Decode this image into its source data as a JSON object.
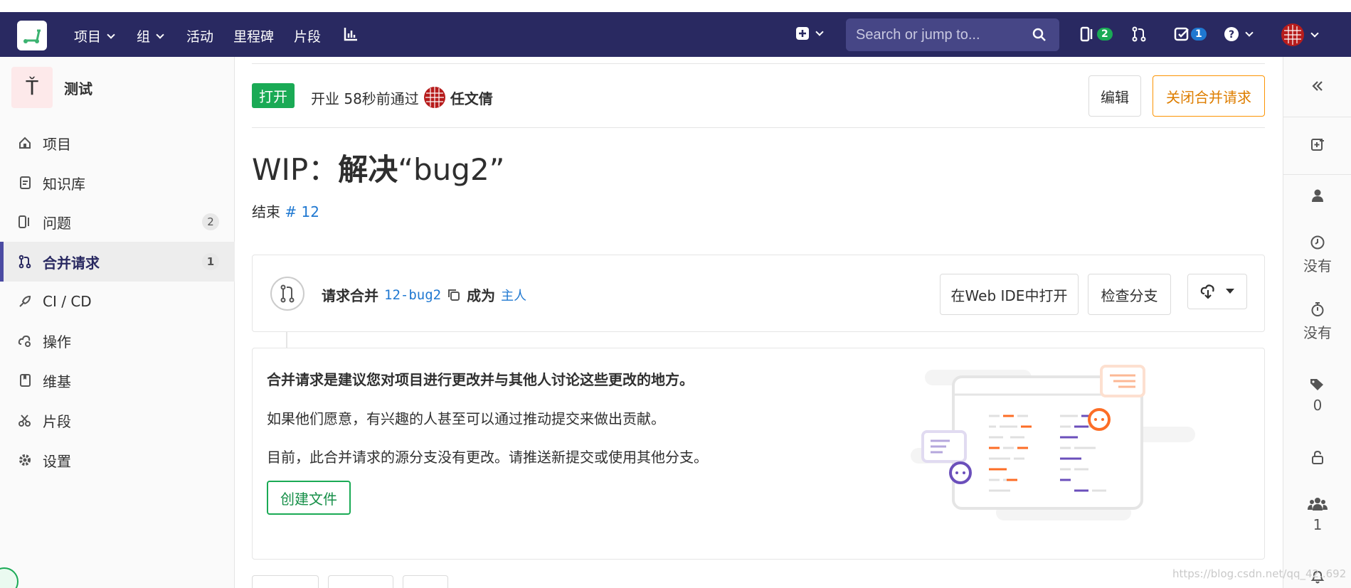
{
  "nav": {
    "items": [
      {
        "label": "项目",
        "caret": true
      },
      {
        "label": "组",
        "caret": true
      },
      {
        "label": "活动",
        "caret": false
      },
      {
        "label": "里程碑",
        "caret": false
      },
      {
        "label": "片段",
        "caret": false
      }
    ],
    "search_placeholder": "Search or jump to...",
    "issues_badge": "2",
    "todos_badge": "1"
  },
  "sidebar": {
    "project_initial": "Ť",
    "project_name": "测试",
    "items": [
      {
        "label": "项目",
        "icon": "home-icon"
      },
      {
        "label": "知识库",
        "icon": "doc-icon"
      },
      {
        "label": "问题",
        "icon": "issues-icon",
        "count": "2"
      },
      {
        "label": "合并请求",
        "icon": "merge-request-icon",
        "count": "1",
        "active": true
      },
      {
        "label": "CI / CD",
        "icon": "rocket-icon"
      },
      {
        "label": "操作",
        "icon": "cloud-gear-icon"
      },
      {
        "label": "维基",
        "icon": "book-icon"
      },
      {
        "label": "片段",
        "icon": "scissors-icon"
      },
      {
        "label": "设置",
        "icon": "gear-icon"
      }
    ]
  },
  "mr": {
    "status": "打开",
    "opened_text": "开业 58秒前通过",
    "author": "任文倩",
    "edit_label": "编辑",
    "close_label": "关闭合并请求",
    "title_prefix": "WIP：",
    "title_main": "解决",
    "title_rest": "“bug2”",
    "closes_label": "结束",
    "closes_issue": "# 12"
  },
  "branch": {
    "request_label": "请求合并",
    "source_branch": "12-bug2",
    "into_label": "成为",
    "target_branch": "主人",
    "web_ide_label": "在Web IDE中打开",
    "checkout_label": "检查分支"
  },
  "empty_state": {
    "heading": "合并请求是建议您对项目进行更改并与其他人讨论这些更改的地方。",
    "line1": "如果他们愿意，有兴趣的人甚至可以通过推动提交来做出贡献。",
    "line2": "目前，此合并请求的源分支没有更改。请推送新提交或使用其他分支。",
    "create_file_label": "创建文件"
  },
  "right_sidebar": {
    "milestone_value": "没有",
    "time_value": "没有",
    "labels_count": "0",
    "participants_count": "1"
  },
  "watermark": "https://blog.csdn.net/qq_42..692"
}
